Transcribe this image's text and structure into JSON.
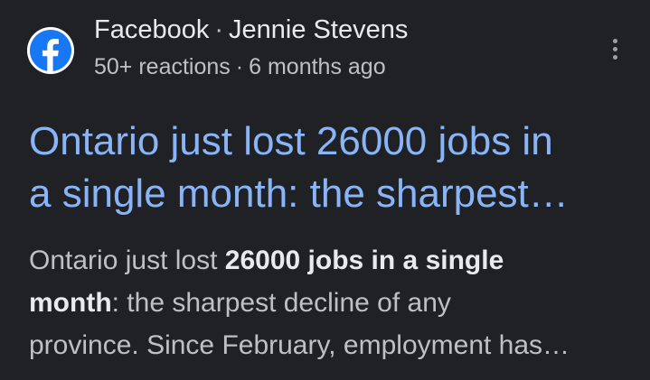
{
  "source": {
    "favicon_icon": "facebook-icon",
    "site_name": "Facebook",
    "separator": "·",
    "author": "Jennie Stevens",
    "reactions": "50+ reactions",
    "age": "6 months ago",
    "more_icon": "more-vert-icon"
  },
  "result": {
    "title_line1": "Ontario just lost 26000 jobs in",
    "title_line2": "a single month: the sharpest…",
    "snippet": {
      "part1": "Ontario just lost ",
      "bold1": "26000",
      "bold2": "jobs in a single",
      "bold3": "month",
      "part2": ": the sharpest decline of any",
      "line3": "province. Since February, employment has…"
    }
  },
  "colors": {
    "background": "#202124",
    "title_link": "#8ab4f8",
    "text_primary": "#e8eaed",
    "text_secondary": "#bdc1c6",
    "facebook_blue": "#1877f2"
  }
}
